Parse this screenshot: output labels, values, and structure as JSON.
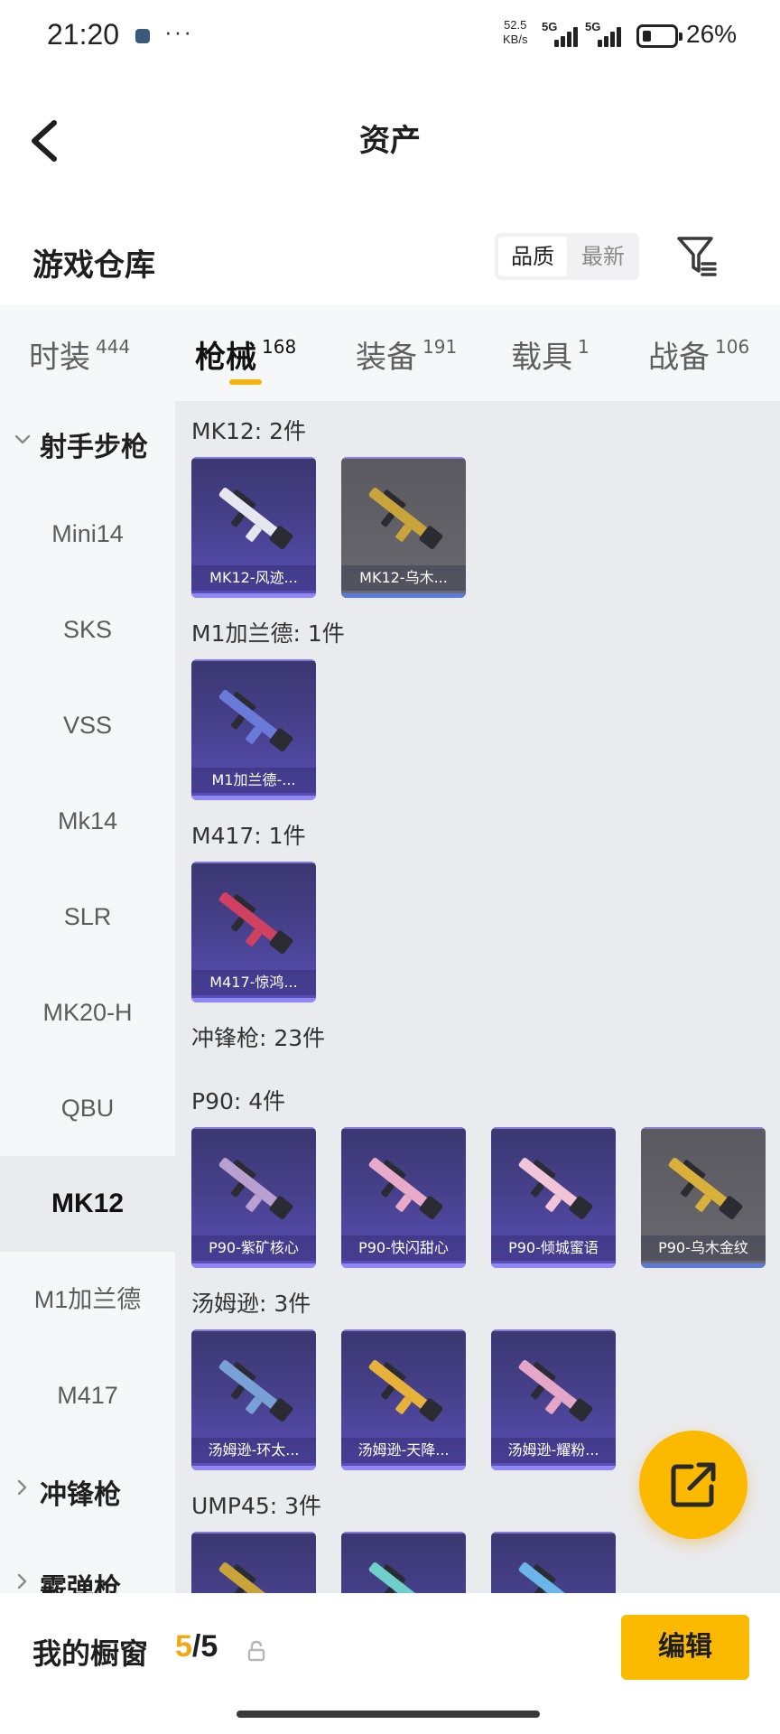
{
  "status_bar": {
    "time": "21:20",
    "dots": "···",
    "speed_value": "52.5",
    "speed_unit": "KB/s",
    "net1": "5G",
    "net2": "5G",
    "battery_level": 0.26,
    "battery": "26%"
  },
  "header": {
    "title": "资产"
  },
  "warehouse": {
    "title": "游戏仓库",
    "sort_options": [
      "品质",
      "最新"
    ],
    "sort_active": "品质"
  },
  "tabs": [
    {
      "label": "时装",
      "count": "444"
    },
    {
      "label": "枪械",
      "count": "168",
      "active": true
    },
    {
      "label": "装备",
      "count": "191"
    },
    {
      "label": "载具",
      "count": "1"
    },
    {
      "label": "战备",
      "count": "106"
    }
  ],
  "sidebar": {
    "group_expanded": "射手步枪",
    "items": [
      "Mini14",
      "SKS",
      "VSS",
      "Mk14",
      "SLR",
      "MK20-H",
      "QBU",
      "MK12",
      "M1加兰德",
      "M417"
    ],
    "active_item": "MK12",
    "group_collapsed_1": "冲锋枪",
    "group_collapsed_2": "霰弹枪"
  },
  "content": {
    "sections": [
      {
        "heading": "MK12: 2件",
        "items": [
          {
            "name": "MK12-风迹...",
            "style": "purple"
          },
          {
            "name": "MK12-乌木...",
            "style": "gray"
          }
        ]
      },
      {
        "heading": "M1加兰德: 1件",
        "items": [
          {
            "name": "M1加兰德-...",
            "style": "purple"
          }
        ]
      },
      {
        "heading": "M417: 1件",
        "items": [
          {
            "name": "M417-惊鸿...",
            "style": "purple"
          }
        ]
      },
      {
        "heading": "冲锋枪: 23件",
        "items": []
      },
      {
        "heading": "P90: 4件",
        "items": [
          {
            "name": "P90-紫矿核心",
            "style": "purple"
          },
          {
            "name": "P90-快闪甜心",
            "style": "purple"
          },
          {
            "name": "P90-倾城蜜语",
            "style": "purple"
          },
          {
            "name": "P90-乌木金纹",
            "style": "gray"
          }
        ]
      },
      {
        "heading": "汤姆逊: 3件",
        "items": [
          {
            "name": "汤姆逊-环太...",
            "style": "purple"
          },
          {
            "name": "汤姆逊-天降...",
            "style": "purple"
          },
          {
            "name": "汤姆逊-耀粉...",
            "style": "purple"
          }
        ]
      },
      {
        "heading": "UMP45: 3件",
        "items": [
          {
            "name": "",
            "style": "purple"
          },
          {
            "name": "",
            "style": "purple"
          },
          {
            "name": "",
            "style": "purple"
          }
        ]
      }
    ]
  },
  "bottom_bar": {
    "label": "我的橱窗",
    "current": "5",
    "total": "/5",
    "edit": "编辑"
  },
  "colors": {
    "accent": "#fbb900",
    "card_purple": "#46408a",
    "card_gray": "#626268",
    "gun_gold": "#c9a43a",
    "gun_pink": "#e9a9c8"
  },
  "icons": [
    "back-arrow-icon",
    "filter-icon",
    "chevron-down-icon",
    "chevron-right-icon",
    "lock-icon",
    "share-external-icon"
  ]
}
